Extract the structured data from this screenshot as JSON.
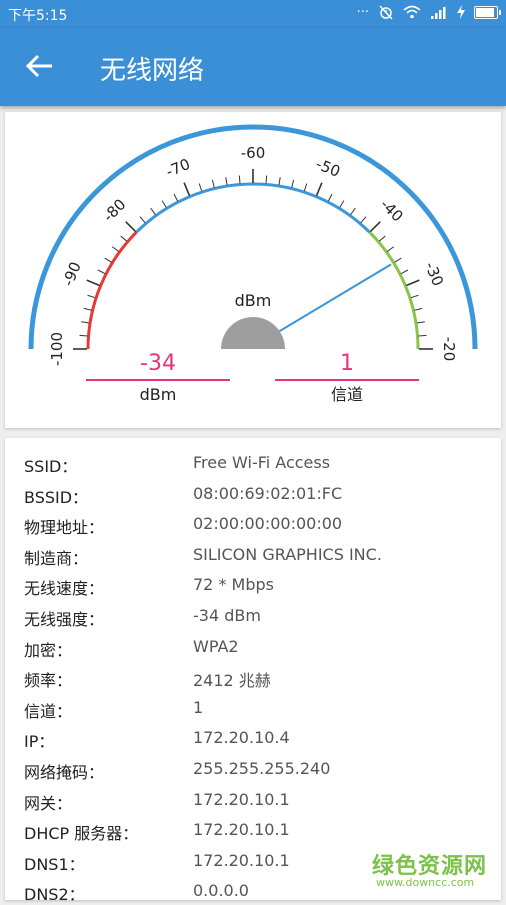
{
  "status_bar": {
    "time": "下午5:15",
    "dots": "···"
  },
  "app_bar": {
    "title": "无线网络"
  },
  "gauge": {
    "unit": "dBm",
    "reading": -34,
    "scale_min": -100,
    "scale_max": -20,
    "ticks": [
      "-100",
      "-90",
      "-80",
      "-70",
      "-60",
      "-50",
      "-40",
      "-30",
      "-20"
    ],
    "signal": {
      "value": "-34",
      "label": "dBm"
    },
    "channel": {
      "value": "1",
      "label": "信道"
    },
    "colors": {
      "arc": "#3a97d9",
      "red": "#e53935",
      "green": "#8bc34a",
      "needle": "#3a97d9",
      "hub": "#9e9e9e",
      "value_text": "#e8327a",
      "underline": "#e8327a"
    }
  },
  "info": {
    "rows": [
      {
        "key": "SSID：",
        "value": "Free Wi-Fi Access"
      },
      {
        "key": "BSSID：",
        "value": "08:00:69:02:01:FC"
      },
      {
        "key": "物理地址：",
        "value": "02:00:00:00:00:00"
      },
      {
        "key": "制造商：",
        "value": "SILICON GRAPHICS INC."
      },
      {
        "key": "无线速度：",
        "value": "72 * Mbps"
      },
      {
        "key": "无线强度：",
        "value": "-34 dBm"
      },
      {
        "key": "加密：",
        "value": "WPA2"
      },
      {
        "key": "频率：",
        "value": "2412 兆赫"
      },
      {
        "key": "信道：",
        "value": "1"
      },
      {
        "key": "IP：",
        "value": "172.20.10.4"
      },
      {
        "key": "网络掩码：",
        "value": "255.255.255.240"
      },
      {
        "key": "网关：",
        "value": "172.20.10.1"
      },
      {
        "key": "DHCP 服务器：",
        "value": "172.20.10.1"
      },
      {
        "key": "DNS1：",
        "value": "172.20.10.1"
      },
      {
        "key": "DNS2：",
        "value": "0.0.0.0"
      }
    ]
  },
  "watermark": {
    "line1": "绿色资源网",
    "line2": "www.downcc.com"
  }
}
